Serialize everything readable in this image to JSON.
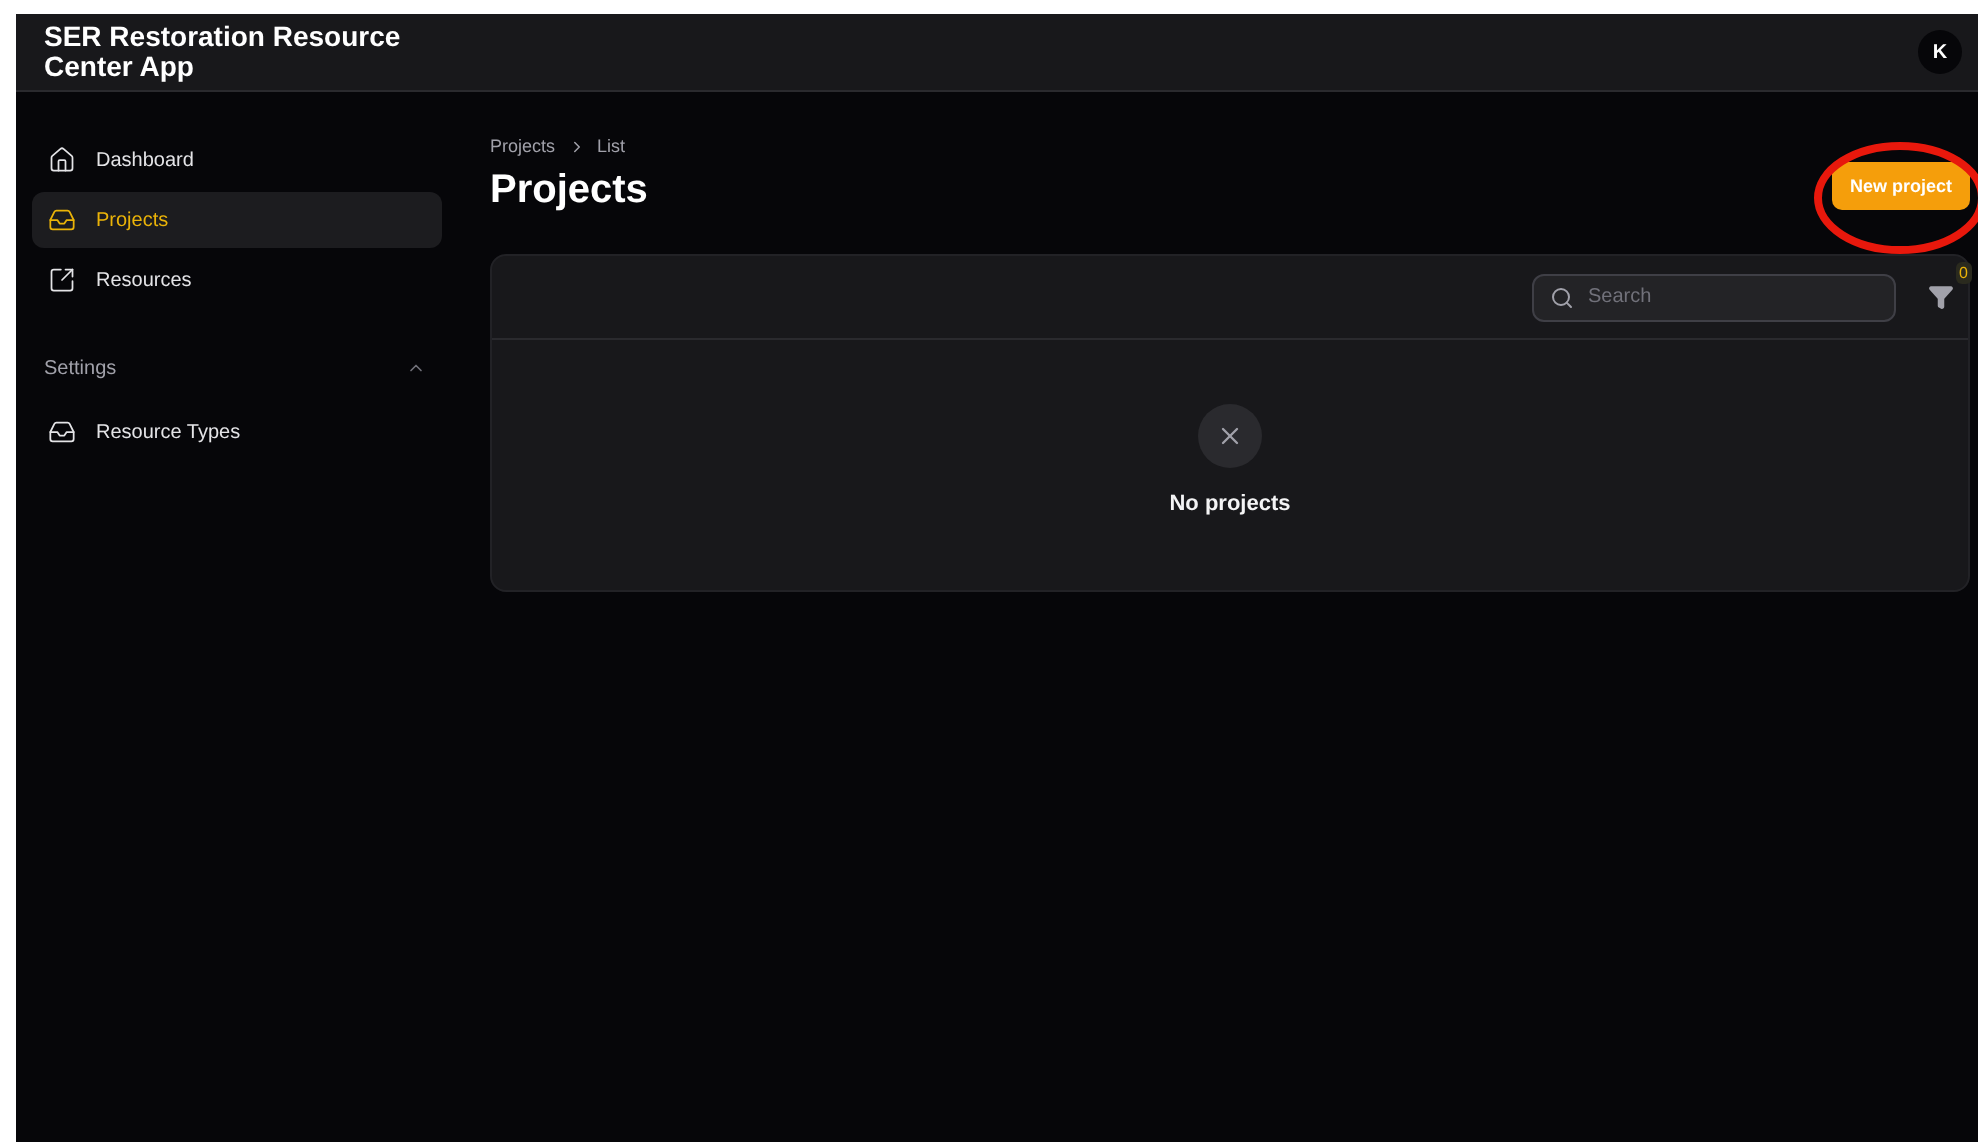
{
  "app_title": "SER Restoration Resource Center App",
  "user_avatar": "K",
  "sidebar": {
    "items": [
      {
        "label": "Dashboard",
        "kind": "home",
        "selected": false
      },
      {
        "label": "Projects",
        "kind": "tray",
        "selected": true
      },
      {
        "label": "Resources",
        "kind": "link",
        "selected": false
      }
    ],
    "sections": [
      {
        "title": "Settings",
        "expanded": true,
        "items": [
          {
            "label": "Resource Types",
            "kind": "tray",
            "selected": false
          }
        ]
      }
    ]
  },
  "breadcrumb": [
    "Projects",
    "List"
  ],
  "page_title": "Projects",
  "new_button": {
    "label": "New project",
    "highlighted": true
  },
  "search": {
    "placeholder": "Search"
  },
  "filter": {
    "count": "0"
  },
  "empty_state": {
    "message": "No projects"
  }
}
